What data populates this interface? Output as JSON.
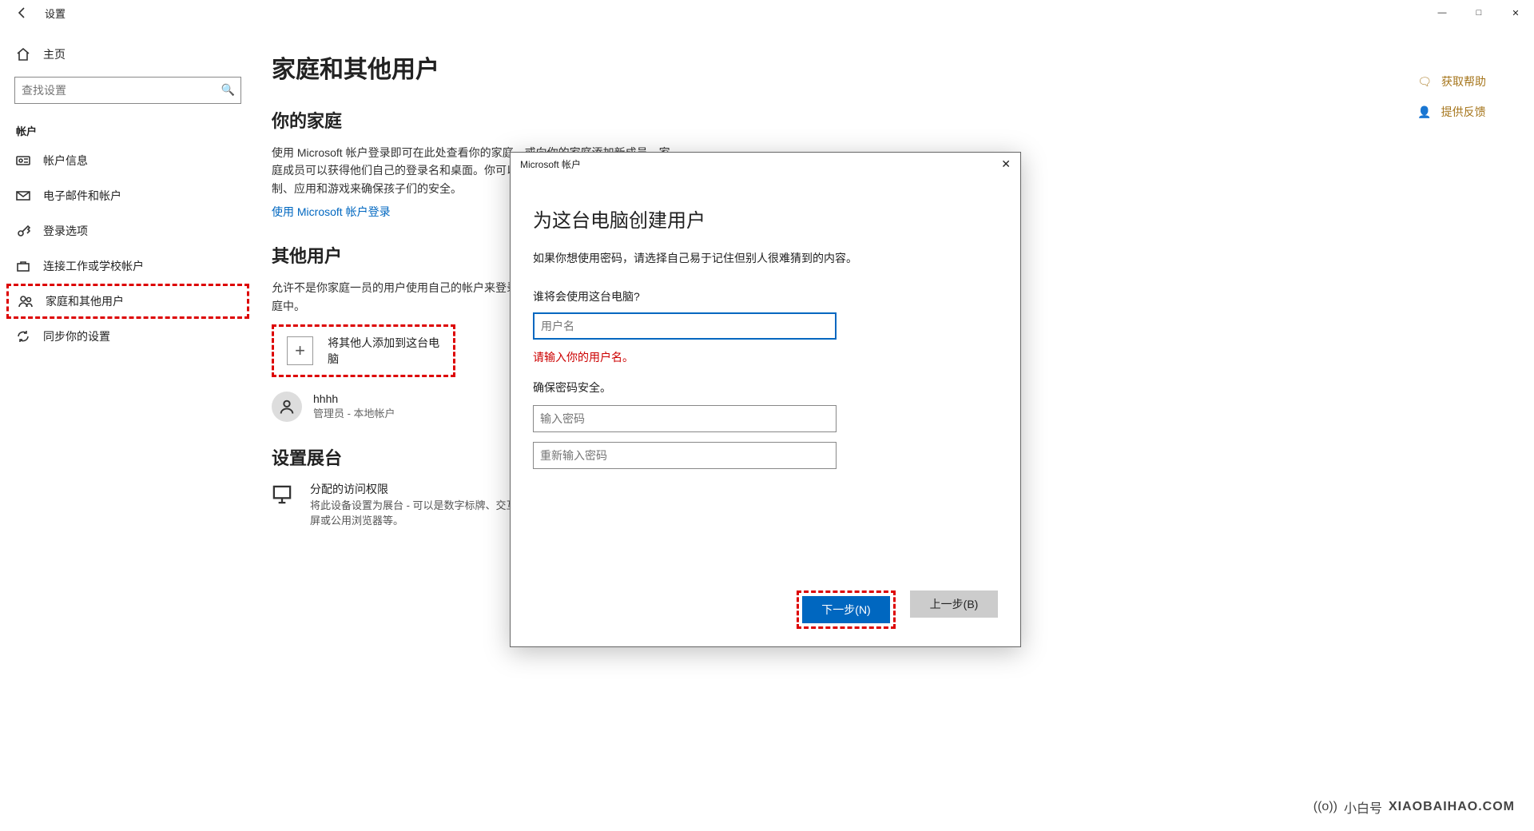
{
  "window": {
    "back_icon": "back-arrow-icon",
    "title": "设置",
    "minimize": "—",
    "maximize": "□",
    "close": "✕"
  },
  "sidebar": {
    "home": "主页",
    "search_placeholder": "查找设置",
    "section": "帐户",
    "items": [
      {
        "icon": "id-card-icon",
        "label": "帐户信息"
      },
      {
        "icon": "mail-icon",
        "label": "电子邮件和帐户"
      },
      {
        "icon": "key-icon",
        "label": "登录选项"
      },
      {
        "icon": "briefcase-icon",
        "label": "连接工作或学校帐户"
      },
      {
        "icon": "people-icon",
        "label": "家庭和其他用户"
      },
      {
        "icon": "sync-icon",
        "label": "同步你的设置"
      }
    ]
  },
  "content": {
    "h1": "家庭和其他用户",
    "family_h": "你的家庭",
    "family_p": "使用 Microsoft 帐户登录即可在此处查看你的家庭，或向你的家庭添加新成员。家庭成员可以获得他们自己的登录名和桌面。你可以通过设置合适的网站、时间限制、应用和游戏来确保孩子们的安全。",
    "family_link": "使用 Microsoft 帐户登录",
    "others_h": "其他用户",
    "others_p": "允许不是你家庭一员的用户使用自己的帐户来登录。这样不会将其添加到你的家庭中。",
    "add_other": "将其他人添加到这台电脑",
    "user_name": "hhhh",
    "user_role": "管理员 - 本地帐户",
    "kiosk_h": "设置展台",
    "kiosk_title": "分配的访问权限",
    "kiosk_desc": "将此设备设置为展台 - 可以是数字标牌、交互式显示屏或公用浏览器等。"
  },
  "right": {
    "help": "获取帮助",
    "feedback": "提供反馈"
  },
  "modal": {
    "title": "Microsoft 帐户",
    "heading": "为这台电脑创建用户",
    "sub": "如果你想使用密码，请选择自己易于记住但别人很难猜到的内容。",
    "who_label": "谁将会使用这台电脑?",
    "username_ph": "用户名",
    "error": "请输入你的用户名。",
    "pwd_section": "确保密码安全。",
    "pwd_ph": "输入密码",
    "pwd2_ph": "重新输入密码",
    "next": "下一步(N)",
    "back": "上一步(B)"
  },
  "watermark": {
    "name": "小白号",
    "site": "XIAOBAIHAO.COM",
    "logo_text": "小白号",
    "logo_site": "XIAOBAIHAO.COM"
  }
}
